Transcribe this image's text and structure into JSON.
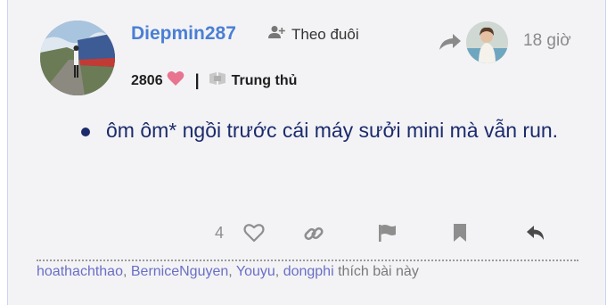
{
  "post": {
    "author": {
      "username": "Diepmin287",
      "follow_label": "Theo đuôi",
      "heart_count": "2806",
      "badge_label": "Trung thủ"
    },
    "timestamp": "18 giờ",
    "body_items": [
      "ôm ôm* ngồi trước cái máy sưởi mini mà vẫn run."
    ],
    "like_count": "4",
    "liked_by": {
      "users": [
        "hoathachthao",
        "BerniceNguyen",
        "Youyu",
        "dongphi"
      ],
      "suffix": "thích bài này"
    }
  },
  "icons": {
    "follow": "user-plus-icon",
    "heart": "heart-icon",
    "badge": "book-badge-icon",
    "reply_to": "share-arrow-icon",
    "like": "heart-outline-icon",
    "link": "link-icon",
    "flag": "flag-icon",
    "bookmark": "bookmark-icon",
    "reply": "reply-icon"
  },
  "colors": {
    "username": "#4a7fd4",
    "body_text": "#1c2b6b",
    "heart": "#e8748f",
    "liker_names": "#6a6fc4",
    "muted": "#8e8e8e"
  }
}
